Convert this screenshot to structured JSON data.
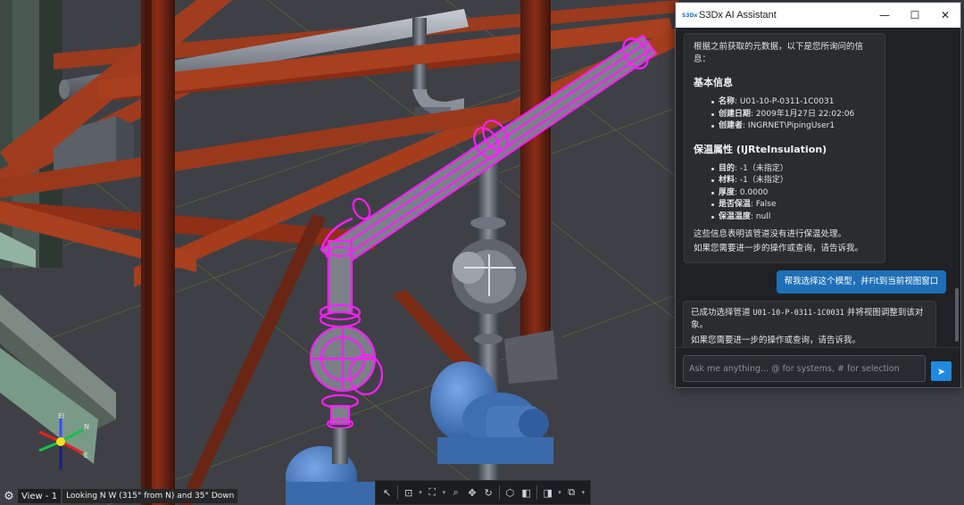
{
  "window": {
    "title": "S3Dx AI Assistant",
    "icon_text": "S3Dx",
    "controls": {
      "minimize": "—",
      "maximize": "☐",
      "close": "✕"
    }
  },
  "messages": {
    "ai_first": {
      "intro": "根据之前获取的元数据，以下是您所询问的信息：",
      "basic_title": "基本信息",
      "basic_items": [
        {
          "label": "名称",
          "value": ": U01-10-P-0311-1C0031"
        },
        {
          "label": "创建日期",
          "value": ": 2009年1月27日 22:02:06"
        },
        {
          "label": "创建者",
          "value": ": INGRNET\\PipingUser1"
        }
      ],
      "insul_title": "保温属性 (IJRteInsulation)",
      "insul_items": [
        {
          "label": "目的",
          "value": ": -1（未指定）"
        },
        {
          "label": "材料",
          "value": ": -1（未指定）"
        },
        {
          "label": "厚度",
          "value": ": 0.0000"
        },
        {
          "label": "是否保温",
          "value": ": False"
        },
        {
          "label": "保温温度",
          "value": ": null"
        }
      ],
      "conclusion": "这些信息表明该管道没有进行保温处理。",
      "followup": "如果您需要进一步的操作或查询，请告诉我。"
    },
    "user": "帮我选择这个模型，并Fit到当前视图窗口",
    "ai_second": {
      "prefix": "已成功选择管道 ",
      "pipe_id": "U01-10-P-0311-1C0031",
      "suffix": " 并将视图调整到该对象。",
      "followup": "如果您需要进一步的操作或查询，请告诉我。"
    }
  },
  "input": {
    "placeholder": "Ask me anything... @ for systems, # for selection",
    "send_icon": "send-icon"
  },
  "status": {
    "settings_icon": "gear-icon",
    "view_name": "View - 1",
    "view_description": "Looking N W (315° from N) and 35° Down"
  },
  "triad": {
    "up": "El",
    "north": "N",
    "east": "E"
  },
  "toolbar_icons": [
    "select-icon",
    "fit-icon",
    "zoom-area-icon",
    "zoom-icon",
    "pan-icon",
    "rotate-icon",
    "cube-view-icon",
    "shaded-icon",
    "clip-icon",
    "clip-box-icon"
  ],
  "colors": {
    "accent": "#1f6fb6",
    "highlight": "#ff1dff",
    "steel": "#a3371e"
  }
}
